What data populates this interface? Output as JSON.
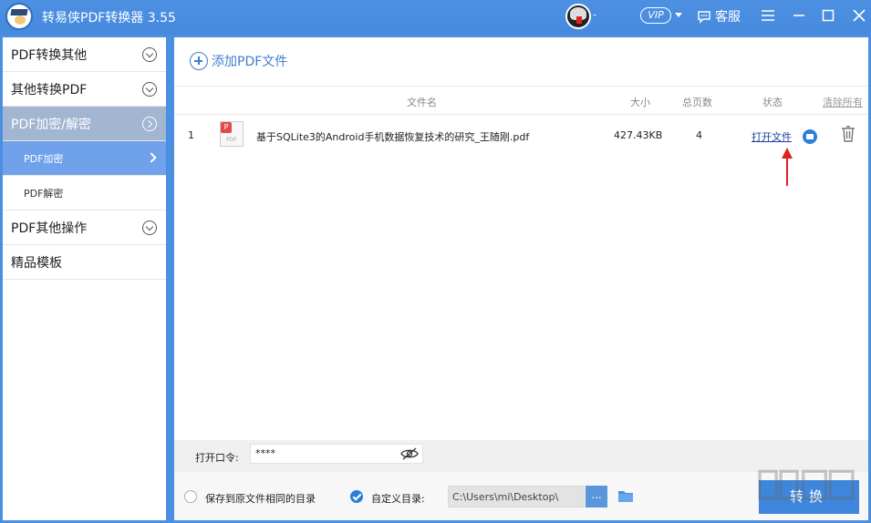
{
  "titlebar": {
    "app_title": "转易侠PDF转换器 3.55",
    "avatar_suffix": "-",
    "vip_label": "VIP",
    "service_label": "客服"
  },
  "sidebar": {
    "items": [
      {
        "label": "PDF转换其他"
      },
      {
        "label": "其他转换PDF"
      },
      {
        "label": "PDF加密/解密"
      },
      {
        "label": "PDF其他操作"
      },
      {
        "label": "精品模板"
      }
    ],
    "subitems": [
      {
        "label": "PDF加密"
      },
      {
        "label": "PDF解密"
      }
    ]
  },
  "main": {
    "add_label": "添加PDF文件",
    "columns": {
      "filename": "文件名",
      "size": "大小",
      "pages": "总页数",
      "status": "状态",
      "clear": "清除所有"
    },
    "files": [
      {
        "index": "1",
        "name": "基于SQLite3的Android手机数据恢复技术的研究_王随刚.pdf",
        "size": "427.43KB",
        "pages": "4",
        "status_link": "打开文件"
      }
    ],
    "pdf_icon_badge": "P",
    "pdf_icon_text": "PDF"
  },
  "bottom": {
    "password_label": "打开口令:",
    "password_value": "****",
    "option_same_dir": "保存到原文件相同的目录",
    "option_custom_dir": "自定义目录:",
    "custom_dir_checked": true,
    "path_value": "C:\\Users\\mi\\Desktop\\",
    "browse_label": "...",
    "convert_label": "转换"
  },
  "colors": {
    "title_bar": "#4a8fe0",
    "accent": "#3e86db",
    "sidebar_active": "#a2b5d1",
    "sidebar_sub_active": "#6fa2eb",
    "link": "#1b3fa0",
    "annotation_arrow": "#e02020"
  }
}
